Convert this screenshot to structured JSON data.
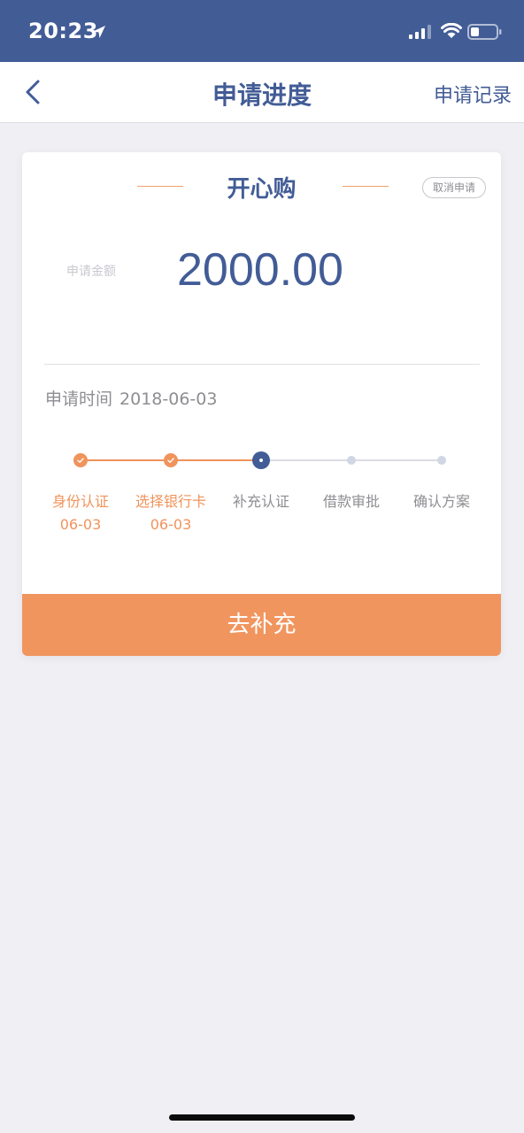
{
  "status_bar": {
    "time": "20:23"
  },
  "nav": {
    "title": "申请进度",
    "right_label": "申请记录"
  },
  "card": {
    "title": "开心购",
    "cancel_label": "取消申请",
    "amount_label": "申请金额",
    "amount_value": "2000.00",
    "apply_time_label": "申请时间",
    "apply_time_value": "2018-06-03",
    "steps": [
      {
        "label": "身份认证",
        "date": "06-03",
        "state": "done"
      },
      {
        "label": "选择银行卡",
        "date": "06-03",
        "state": "done"
      },
      {
        "label": "补充认证",
        "date": "",
        "state": "current"
      },
      {
        "label": "借款审批",
        "date": "",
        "state": "pending"
      },
      {
        "label": "确认方案",
        "date": "",
        "state": "pending"
      }
    ],
    "action_label": "去补充"
  },
  "colors": {
    "brand": "#425c96",
    "accent": "#f1955f",
    "background": "#efeff4"
  }
}
